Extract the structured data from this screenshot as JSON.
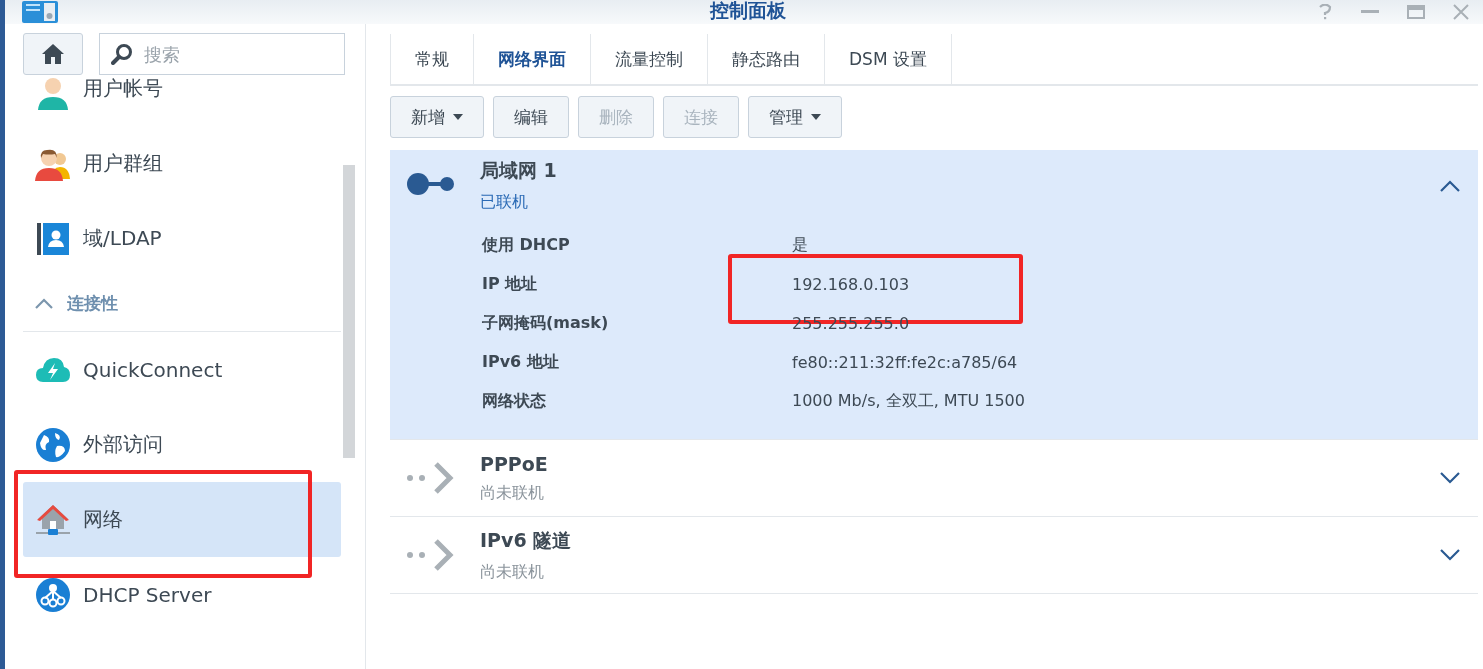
{
  "window": {
    "title": "控制面板"
  },
  "search": {
    "placeholder": "搜索"
  },
  "sidebar": {
    "items": [
      {
        "kind": "item",
        "label": "用户帐号",
        "selected": false,
        "highlighted": false
      },
      {
        "kind": "item",
        "label": "用户群组",
        "selected": false,
        "highlighted": false
      },
      {
        "kind": "item",
        "label": "域/LDAP",
        "selected": false,
        "highlighted": false
      },
      {
        "kind": "section",
        "label": "连接性",
        "expanded": true
      },
      {
        "kind": "item",
        "label": "QuickConnect",
        "selected": false,
        "highlighted": false
      },
      {
        "kind": "item",
        "label": "外部访问",
        "selected": false,
        "highlighted": false
      },
      {
        "kind": "item",
        "label": "网络",
        "selected": true,
        "highlighted": true
      },
      {
        "kind": "item",
        "label": "DHCP Server",
        "selected": false,
        "highlighted": false
      }
    ]
  },
  "tabs": [
    {
      "label": "常规",
      "selected": false
    },
    {
      "label": "网络界面",
      "selected": true
    },
    {
      "label": "流量控制",
      "selected": false
    },
    {
      "label": "静态路由",
      "selected": false
    },
    {
      "label": "DSM 设置",
      "selected": false
    }
  ],
  "toolbar": [
    {
      "label": "新增",
      "disabled": false,
      "dropdown": true
    },
    {
      "label": "编辑",
      "disabled": false,
      "dropdown": false
    },
    {
      "label": "删除",
      "disabled": true,
      "dropdown": false
    },
    {
      "label": "连接",
      "disabled": true,
      "dropdown": false
    },
    {
      "label": "管理",
      "disabled": false,
      "dropdown": true
    }
  ],
  "interfaces": [
    {
      "name": "局域网 1",
      "status": "已联机",
      "connected": true,
      "expanded": true,
      "details": [
        {
          "label": "使用 DHCP",
          "value": "是",
          "highlighted": false
        },
        {
          "label": "IP 地址",
          "value": "192.168.0.103",
          "highlighted": true
        },
        {
          "label": "子网掩码(mask)",
          "value": "255.255.255.0",
          "highlighted": false
        },
        {
          "label": "IPv6 地址",
          "value": "fe80::211:32ff:fe2c:a785/64",
          "highlighted": false
        },
        {
          "label": "网络状态",
          "value": "1000 Mb/s, 全双工, MTU 1500",
          "highlighted": false
        }
      ]
    },
    {
      "name": "PPPoE",
      "status": "尚未联机",
      "connected": false,
      "expanded": false
    },
    {
      "name": "IPv6 隧道",
      "status": "尚未联机",
      "connected": false,
      "expanded": false
    }
  ]
}
